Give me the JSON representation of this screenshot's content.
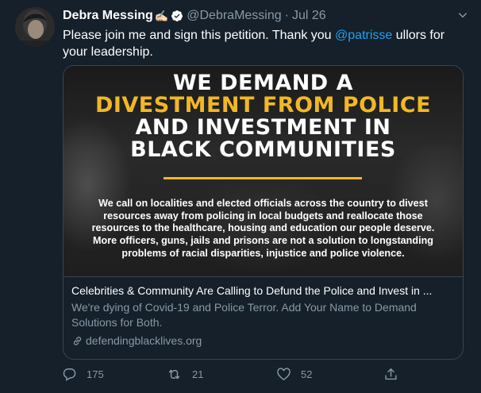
{
  "tweet": {
    "display_name": "Debra Messing",
    "name_emoji": "✍🏻",
    "handle": "@DebraMessing",
    "separator": "·",
    "date": "Jul 26",
    "text_before": "Please join me and sign this petition. Thank you ",
    "mention": "@patrisse",
    "text_after": " ullors for your leadership."
  },
  "card": {
    "image": {
      "headline_line1": "WE DEMAND A",
      "headline_line2": "DIVESTMENT FROM POLICE",
      "headline_line3": "AND INVESTMENT IN",
      "headline_line4": "BLACK COMMUNITIES",
      "body": "We call on localities and elected officials across the country to divest resources away from policing in local budgets and reallocate those resources to the healthcare, housing and education our people deserve. More officers, guns, jails and prisons are not a solution to longstanding problems of racial disparities, injustice and police violence."
    },
    "title": "Celebrities & Community Are Calling to Defund the Police and Invest in ...",
    "description": "We're dying of Covid-19 and Police Terror. Add Your Name to Demand Solutions for Both.",
    "link": "defendingblacklives.org"
  },
  "actions": {
    "reply_count": "175",
    "retweet_count": "21",
    "like_count": "52"
  },
  "colors": {
    "background": "#15202b",
    "accent": "#1da1f2",
    "muted": "#8899a6",
    "gold": "#f2b823",
    "border": "#38444d"
  },
  "icons": [
    "verified-icon",
    "chevron-down-icon",
    "reply-icon",
    "retweet-icon",
    "like-icon",
    "share-icon",
    "link-icon"
  ]
}
